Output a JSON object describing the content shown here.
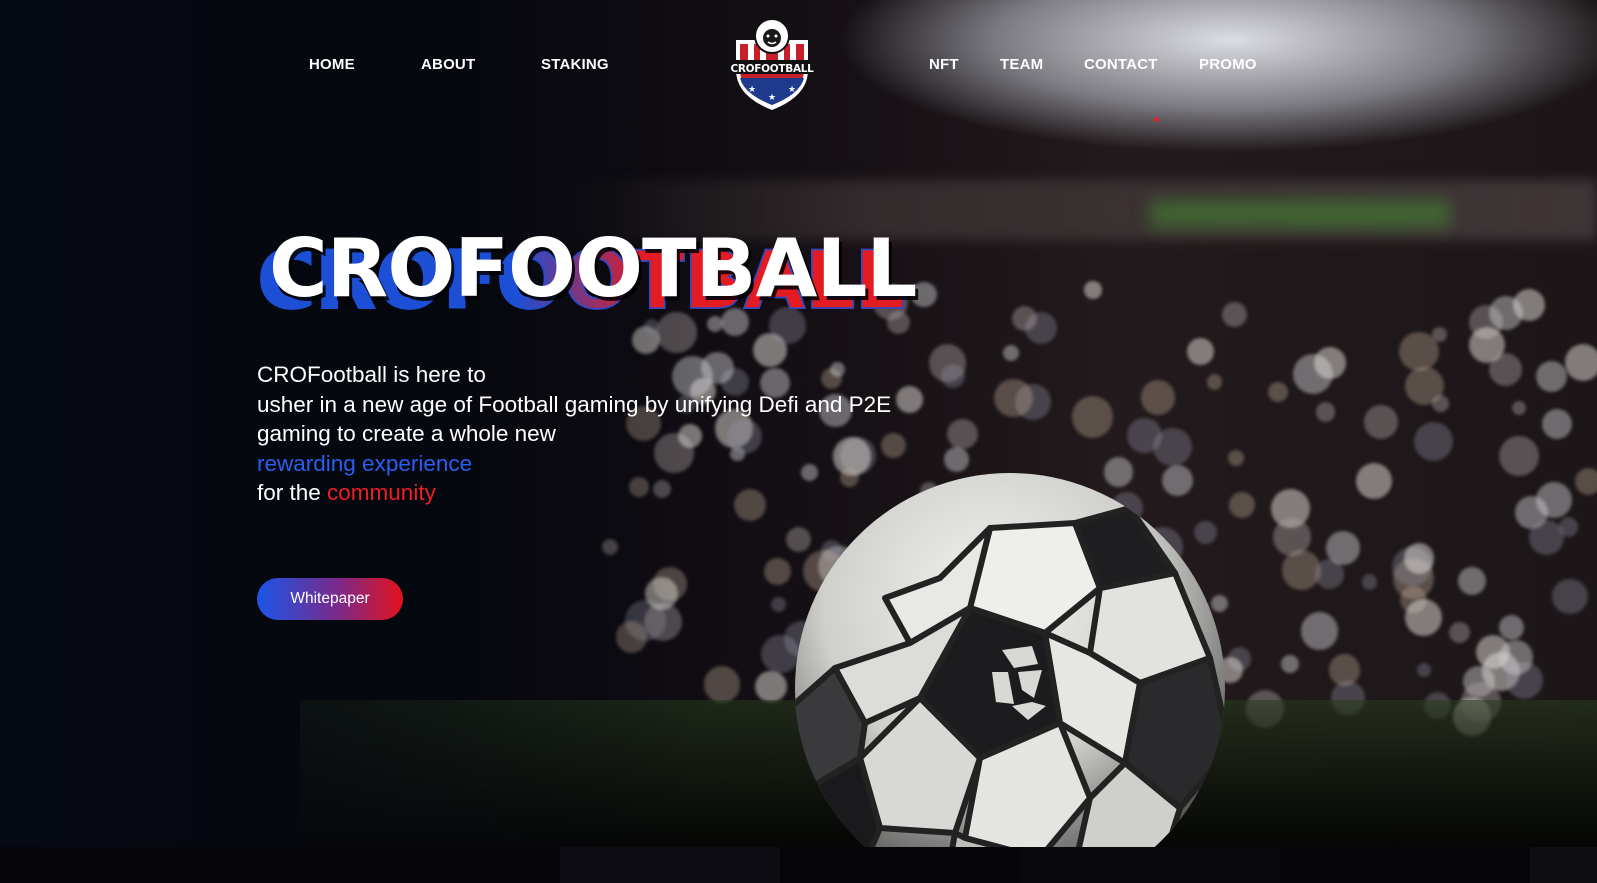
{
  "nav": {
    "left": [
      {
        "label": "HOME"
      },
      {
        "label": "ABOUT"
      },
      {
        "label": "STAKING"
      }
    ],
    "right": [
      {
        "label": "NFT"
      },
      {
        "label": "TEAM"
      },
      {
        "label": "CONTACT"
      },
      {
        "label": "PROMO"
      }
    ]
  },
  "logo": {
    "text": "CROFOOTBALL",
    "icon": "lion-shield-logo-icon"
  },
  "hero": {
    "title": "CROFOOTBALL",
    "description": {
      "line1": "CROFootball is here to",
      "line2": "usher in a new age of Football gaming by unifying Defi and P2E",
      "line3": "gaming to create a whole new",
      "highlight_blue": "rewarding experience",
      "line5_prefix": "for the ",
      "highlight_red": "community"
    },
    "button_label": "Whitepaper"
  },
  "colors": {
    "accent_blue": "#2a5ef0",
    "accent_red": "#ef1d25",
    "background": "#07070b"
  },
  "background_icons": {
    "ball": "soccer-ball-icon",
    "cro_logo": "cro-logo-icon"
  }
}
